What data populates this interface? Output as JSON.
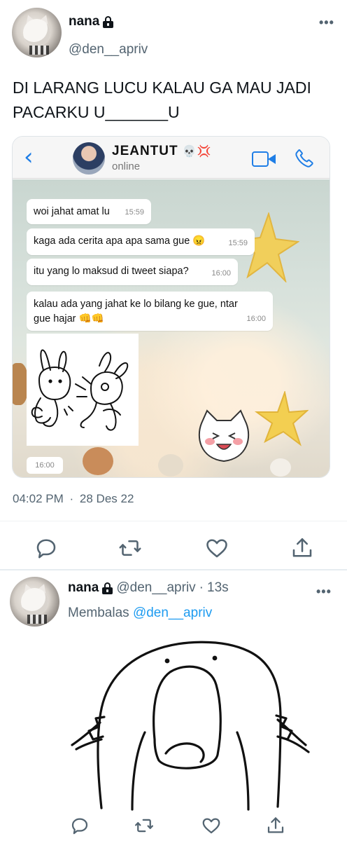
{
  "tweet": {
    "author_name": "nana",
    "author_handle": "@den__apriv",
    "text": "DI LARANG LUCU KALAU GA MAU JADI PACARKU U_______U",
    "timestamp": "04:02 PM",
    "date": "28 Des 22",
    "more_icon": "more-horizontal-icon",
    "actions": [
      "reply-icon",
      "retweet-icon",
      "like-icon",
      "share-icon"
    ]
  },
  "chat_screenshot": {
    "contact_name": "JEANTUT",
    "contact_emoji": "💀💢",
    "contact_status": "online",
    "messages": [
      {
        "text": "woi jahat amat lu",
        "time": "15:59"
      },
      {
        "text": "kaga ada cerita apa apa sama gue 😠",
        "time": "15:59"
      },
      {
        "text": "itu yang lo maksud di tweet siapa?",
        "time": "16:00"
      },
      {
        "text": "kalau ada yang jahat ke lo bilang ke gue, ntar gue hajar 👊👊",
        "time": "16:00"
      }
    ],
    "sticker_time": "16:00",
    "colors": {
      "accent": "#1f7ee6",
      "bubble": "#ffffff"
    }
  },
  "reply": {
    "author_name": "nana",
    "author_handle": "@den__apriv",
    "separator": "·",
    "age": "13s",
    "replying_prefix": "Membalas",
    "replying_to": "@den__apriv"
  },
  "colors": {
    "text": "#0f1419",
    "secondary": "#536471",
    "link": "#1d9bf0"
  }
}
